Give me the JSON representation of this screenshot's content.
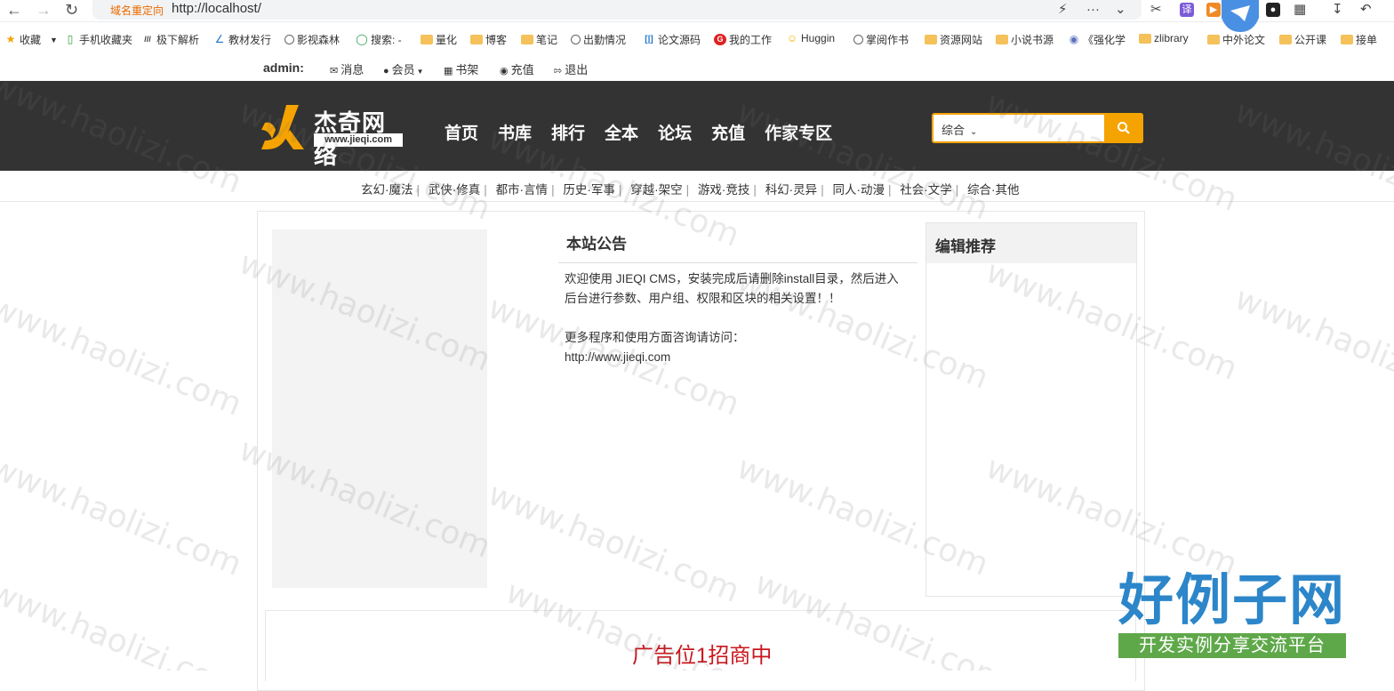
{
  "browser": {
    "redirect_label": "域名重定向",
    "url": "http://localhost/",
    "bookmarks": [
      {
        "label": "收藏",
        "icon": "star-icon"
      },
      {
        "label": "手机收藏夹",
        "icon": "phone-icon"
      },
      {
        "label": "极下解析",
        "icon": "site-icon"
      },
      {
        "label": "教材发行",
        "icon": "site-icon"
      },
      {
        "label": "影视森林",
        "icon": "globe-icon"
      },
      {
        "label": "搜索: -",
        "icon": "share-icon"
      },
      {
        "label": "量化",
        "icon": "folder-icon"
      },
      {
        "label": "博客",
        "icon": "folder-icon"
      },
      {
        "label": "笔记",
        "icon": "folder-icon"
      },
      {
        "label": "出勤情况",
        "icon": "globe-icon"
      },
      {
        "label": "论文源码",
        "icon": "site-icon"
      },
      {
        "label": "我的工作",
        "icon": "site-icon"
      },
      {
        "label": "Huggin",
        "icon": "site-icon"
      },
      {
        "label": "掌阅作书",
        "icon": "globe-icon"
      },
      {
        "label": "资源网站",
        "icon": "folder-icon"
      },
      {
        "label": "小说书源",
        "icon": "folder-icon"
      },
      {
        "label": "《强化学",
        "icon": "site-icon"
      },
      {
        "label": "zlibrary",
        "icon": "folder-icon"
      },
      {
        "label": "中外论文",
        "icon": "folder-icon"
      },
      {
        "label": "公开课",
        "icon": "folder-icon"
      },
      {
        "label": "接单",
        "icon": "folder-icon"
      }
    ]
  },
  "userbar": {
    "username": "admin:",
    "message": "消息",
    "member": "会员",
    "bookshelf": "书架",
    "recharge": "充值",
    "logout": "退出"
  },
  "header": {
    "logo_title": "杰奇网络",
    "logo_url": "www.jieqi.com",
    "nav": [
      "首页",
      "书库",
      "排行",
      "全本",
      "论坛",
      "充值",
      "作家专区"
    ],
    "search_scope": "综合",
    "search_placeholder": ""
  },
  "categories": [
    "玄幻·魔法",
    "武侠·修真",
    "都市·言情",
    "历史·军事",
    "穿越·架空",
    "游戏·竞技",
    "科幻·灵异",
    "同人·动漫",
    "社会·文学",
    "综合·其他"
  ],
  "notice": {
    "title": "本站公告",
    "line1": "欢迎使用 JIEQI CMS，安装完成后请删除install目录，然后进入后台进行参数、用户组、权限和区块的相关设置！！",
    "line2": "更多程序和使用方面咨询请访问：",
    "line3": "http://www.jieqi.com"
  },
  "recommend": {
    "title": "编辑推荐"
  },
  "ad": {
    "text": "广告位1招商中"
  },
  "watermark": {
    "text": "www.haolizi.com",
    "brand": "好例子网",
    "brand_sub": "开发实例分享交流平台"
  },
  "colors": {
    "accent": "#f5a300",
    "header_bg": "#333333",
    "ad_red": "#c9171e",
    "brand_blue": "#2c86c9",
    "brand_green": "#5fa84a"
  }
}
